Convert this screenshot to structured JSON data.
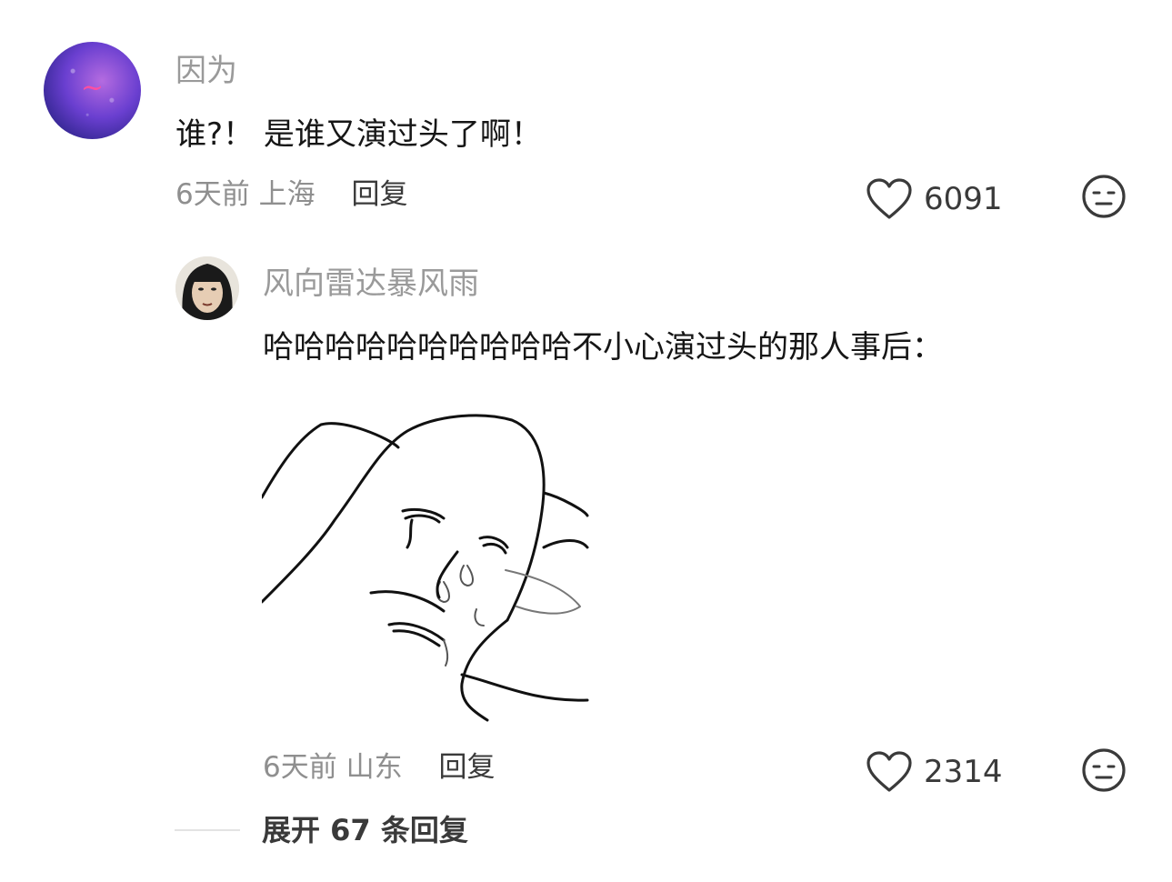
{
  "comment": {
    "username": "因为",
    "text": "谁?！ 是谁又演过头了啊！",
    "time": "6天前",
    "location": "上海",
    "reply_label": "回复",
    "likes": "6091",
    "icons": [
      "heart-icon",
      "neutral-face-icon"
    ]
  },
  "reply": {
    "username": "风向雷达暴风雨",
    "text": "哈哈哈哈哈哈哈哈哈哈不小心演过头的那人事后：",
    "time": "6天前",
    "location": "山东",
    "reply_label": "回复",
    "likes": "2314",
    "icons": [
      "heart-icon",
      "neutral-face-icon"
    ]
  },
  "expand": {
    "label": "展开 67 条回复"
  },
  "colors": {
    "text": "#161616",
    "muted": "#9a9a9a",
    "accent": "#3a3a3a"
  }
}
